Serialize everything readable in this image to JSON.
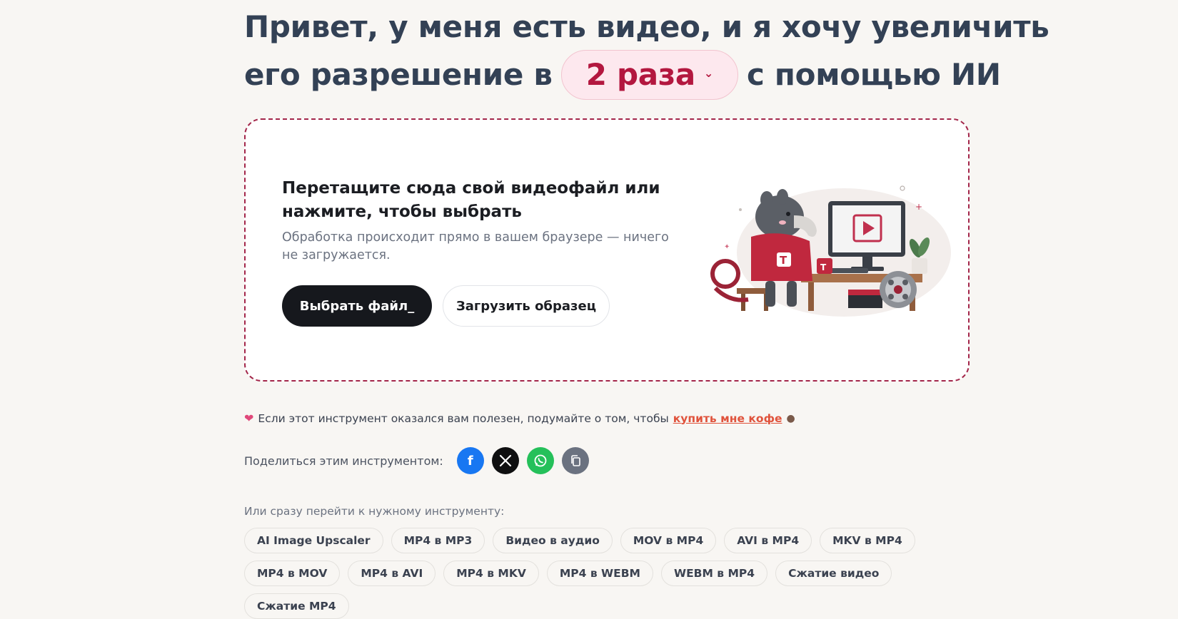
{
  "headline": {
    "line1": "Привет, у меня есть видео, и я хочу увеличить",
    "line2_before": "его разрешение в",
    "scale_value": "2 раза",
    "line2_after": "с помощью ИИ"
  },
  "dropzone": {
    "title": "Перетащите сюда свой видеофайл или нажмите, чтобы выбрать",
    "subtitle": "Обработка происходит прямо в вашем браузере — ничего не загружается.",
    "choose_button": "Выбрать файл_",
    "sample_button": "Загрузить образец",
    "illustration_badge": "T"
  },
  "support": {
    "text": "Если этот инструмент оказался вам полезен, подумайте о том, чтобы",
    "link": "купить мне кофе"
  },
  "share": {
    "label": "Поделиться этим инструментом:",
    "icons": [
      "facebook-icon",
      "x-icon",
      "whatsapp-icon",
      "copy-icon"
    ]
  },
  "tools": {
    "label": "Или сразу перейти к нужному инструменту:",
    "items": [
      "AI Image Upscaler",
      "MP4 в MP3",
      "Видео в аудио",
      "MOV в MP4",
      "AVI в MP4",
      "MKV в MP4",
      "MP4 в MOV",
      "MP4 в AVI",
      "MP4 в MKV",
      "MP4 в WEBM",
      "WEBM в MP4",
      "Сжатие видео",
      "Сжатие MP4"
    ]
  },
  "colors": {
    "accent": "#b3173f",
    "accent_bg": "#fde8ee",
    "link": "#e0533c",
    "background": "#f8f6f3"
  }
}
